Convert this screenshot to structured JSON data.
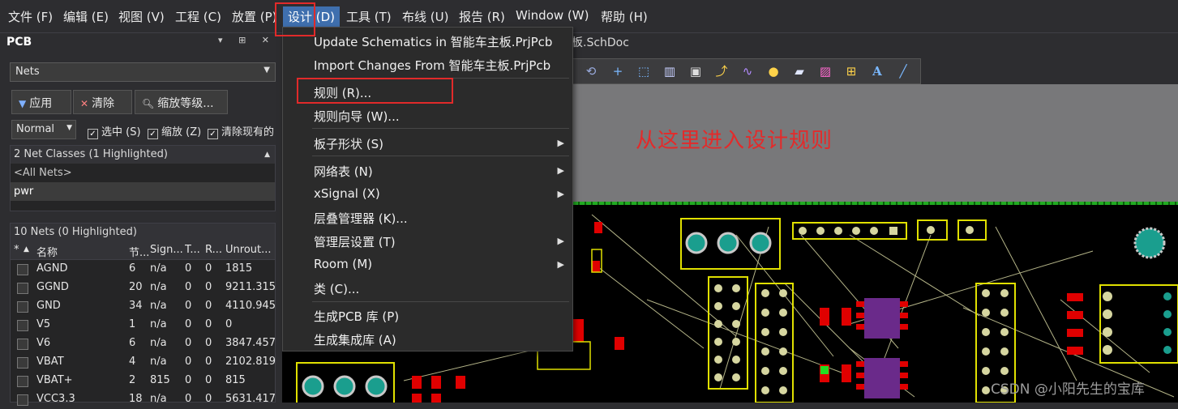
{
  "menubar": {
    "items": [
      "文件 (F)",
      "编辑 (E)",
      "视图 (V)",
      "工程 (C)",
      "放置 (P)",
      "设计 (D)",
      "工具 (T)",
      "布线 (U)",
      "报告 (R)",
      "Window (W)",
      "帮助 (H)"
    ],
    "active_index": 5
  },
  "panel": {
    "title": "PCB",
    "controls": "▾ ⊞ ✕",
    "dropdown_value": "Nets",
    "buttons": {
      "apply": "应用",
      "clear": "清除",
      "zoom": "缩放等级..."
    },
    "mode_value": "Normal",
    "checks": {
      "select": "选中 (S)",
      "zoom": "缩放 (Z)",
      "clear_existing": "清除现有的"
    },
    "classes": {
      "header": "2 Net Classes (1 Highlighted)",
      "items": [
        "<All Nets>",
        "pwr"
      ],
      "selected_index": 1
    },
    "nets": {
      "header": "10 Nets (0 Highlighted)",
      "columns": [
        "*",
        "名称",
        "节...",
        "Sign...",
        "T...",
        "R...",
        "Unrout..."
      ],
      "rows": [
        {
          "name": "AGND",
          "nodes": "6",
          "signal": "n/a",
          "t": "0",
          "r": "0",
          "unrouted": "1815"
        },
        {
          "name": "GGND",
          "nodes": "20",
          "signal": "n/a",
          "t": "0",
          "r": "0",
          "unrouted": "9211.315"
        },
        {
          "name": "GND",
          "nodes": "34",
          "signal": "n/a",
          "t": "0",
          "r": "0",
          "unrouted": "4110.945"
        },
        {
          "name": "V5",
          "nodes": "1",
          "signal": "n/a",
          "t": "0",
          "r": "0",
          "unrouted": "0"
        },
        {
          "name": "V6",
          "nodes": "6",
          "signal": "n/a",
          "t": "0",
          "r": "0",
          "unrouted": "3847.457"
        },
        {
          "name": "VBAT",
          "nodes": "4",
          "signal": "n/a",
          "t": "0",
          "r": "0",
          "unrouted": "2102.819"
        },
        {
          "name": "VBAT+",
          "nodes": "2",
          "signal": "815",
          "t": "0",
          "r": "0",
          "unrouted": "815"
        },
        {
          "name": "VCC3.3",
          "nodes": "18",
          "signal": "n/a",
          "t": "0",
          "r": "0",
          "unrouted": "5631.417"
        }
      ]
    }
  },
  "doc_tab": "板.SchDoc",
  "design_menu": {
    "items": [
      {
        "label": "Update Schematics in 智能车主板.PrjPcb",
        "submenu": false
      },
      {
        "label": "Import Changes From 智能车主板.PrjPcb",
        "submenu": false
      },
      {
        "label": "规则 (R)...",
        "submenu": false
      },
      {
        "label": "规则向导 (W)...",
        "submenu": false
      },
      {
        "label": "板子形状 (S)",
        "submenu": true
      },
      {
        "label": "网络表 (N)",
        "submenu": true
      },
      {
        "label": "xSignal (X)",
        "submenu": true
      },
      {
        "label": "层叠管理器 (K)...",
        "submenu": false
      },
      {
        "label": "管理层设置 (T)",
        "submenu": true
      },
      {
        "label": "Room (M)",
        "submenu": true
      },
      {
        "label": "类 (C)...",
        "submenu": false
      },
      {
        "label": "生成PCB 库 (P)",
        "submenu": false
      },
      {
        "label": "生成集成库 (A)",
        "submenu": false
      }
    ]
  },
  "annotation": "从这里进入设计规则",
  "watermark": "CSDN @小阳先生的宝库",
  "toolbar_icons": [
    "route-icon",
    "plus-icon",
    "select-rect-icon",
    "bar-icon",
    "component-icon",
    "interactive-route-icon",
    "diff-pair-icon",
    "pin-icon",
    "fill-icon",
    "region-icon",
    "dimension-icon",
    "text-icon",
    "line-icon"
  ],
  "colors": {
    "accent": "#3f6fae",
    "highlight_box": "#e12a2a",
    "annotation": "#e42a2a",
    "board_edge": "#22aa22",
    "pad": "#1a9e8e"
  }
}
